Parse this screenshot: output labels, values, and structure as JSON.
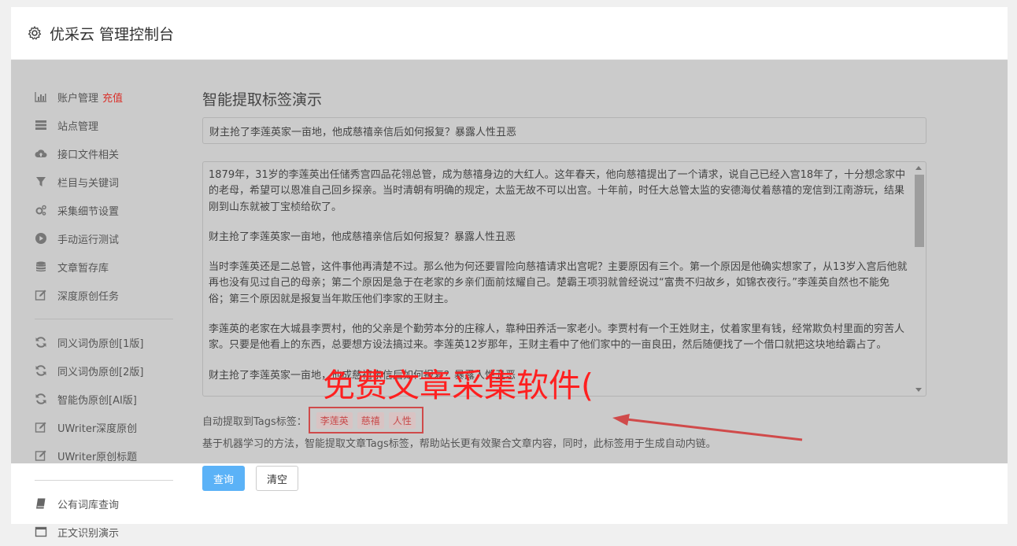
{
  "header": {
    "icon": "gear-icon",
    "title": "优采云 管理控制台"
  },
  "sidebar": {
    "items": [
      {
        "label": "账户管理",
        "badge": "充值",
        "icon": "bar-chart-icon"
      },
      {
        "label": "站点管理",
        "icon": "server-icon"
      },
      {
        "label": "接口文件相关",
        "icon": "cloud-upload-icon"
      },
      {
        "label": "栏目与关键词",
        "icon": "filter-icon"
      },
      {
        "label": "采集细节设置",
        "icon": "cogs-icon"
      },
      {
        "label": "手动运行测试",
        "icon": "play-circle-icon"
      },
      {
        "label": "文章暂存库",
        "icon": "database-icon"
      },
      {
        "label": "深度原创任务",
        "icon": "edit-icon"
      },
      {
        "label": "同义词伪原创[1版]",
        "icon": "refresh-icon"
      },
      {
        "label": "同义词伪原创[2版]",
        "icon": "refresh-icon"
      },
      {
        "label": "智能伪原创[AI版]",
        "icon": "refresh-icon"
      },
      {
        "label": "UWriter深度原创",
        "icon": "edit-icon"
      },
      {
        "label": "UWriter原创标题",
        "icon": "edit-icon"
      },
      {
        "label": "公有词库查询",
        "icon": "book-icon"
      },
      {
        "label": "正文识别演示",
        "icon": "window-icon"
      }
    ]
  },
  "main": {
    "heading": "智能提取标签演示",
    "title_value": "财主抢了李莲英家一亩地，他成慈禧亲信后如何报复？暴露人性丑恶",
    "body_paragraphs": [
      "1879年，31岁的李莲英出任储秀宫四品花翎总管，成为慈禧身边的大红人。这年春天，他向慈禧提出了一个请求，说自己已经入宫18年了，十分想念家中的老母，希望可以恩准自己回乡探亲。当时清朝有明确的规定，太监无故不可以出宫。十年前，时任大总管太监的安德海仗着慈禧的宠信到江南游玩，结果刚到山东就被丁宝桢给砍了。",
      "财主抢了李莲英家一亩地，他成慈禧亲信后如何报复？暴露人性丑恶",
      "当时李莲英还是二总管，这件事他再清楚不过。那么他为何还要冒险向慈禧请求出宫呢？主要原因有三个。第一个原因是他确实想家了，从13岁入宫后他就再也没有见过自己的母亲；第二个原因是急于在老家的乡亲们面前炫耀自己。楚霸王项羽就曾经说过“富贵不归故乡，如锦衣夜行。”李莲英自然也不能免俗；第三个原因就是报复当年欺压他们李家的王财主。",
      "李莲英的老家在大城县李贾村，他的父亲是个勤劳本分的庄稼人，靠种田养活一家老小。李贾村有一个王姓财主，仗着家里有钱，经常欺负村里面的穷苦人家。只要是他看上的东西，总要想方设法搞过来。李莲英12岁那年，王财主看中了他们家中的一亩良田，然后随便找了一个借口就把这块地给霸占了。",
      "财主抢了李莲英家一亩地，他成慈禧亲信后如何报复？暴露人性丑恶"
    ],
    "overlay_caption": "免费文章采集软件(",
    "tags_label": "自动提取到Tags标签：",
    "tags": [
      "李莲英",
      "慈禧",
      "人性"
    ],
    "description": "基于机器学习的方法，智能提取文章Tags标签，帮助站长更有效聚合文章内容，同时，此标签用于生成自动内链。",
    "query_button": "查询",
    "clear_button": "清空"
  },
  "colors": {
    "overlay_red": "#ff2020",
    "primary_button": "#5bb2f7",
    "tag_red": "#c84a4a",
    "gray_mask": "#cbcbcb"
  }
}
